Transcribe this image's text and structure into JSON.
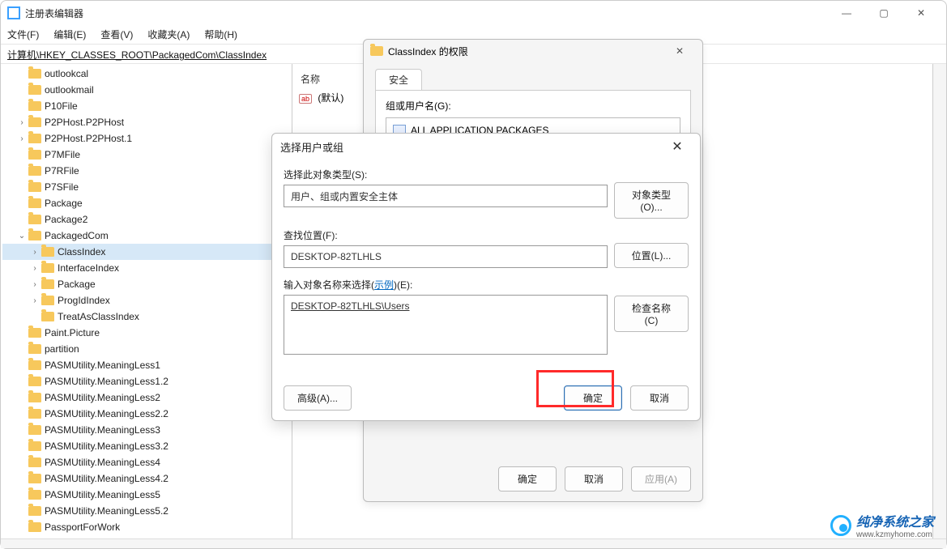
{
  "window": {
    "title": "注册表编辑器",
    "min_icon": "—",
    "max_icon": "▢",
    "close_icon": "✕"
  },
  "menubar": {
    "file": "文件(F)",
    "edit": "编辑(E)",
    "view": "查看(V)",
    "fav": "收藏夹(A)",
    "help": "帮助(H)"
  },
  "address": "计算机\\HKEY_CLASSES_ROOT\\PackagedCom\\ClassIndex",
  "right": {
    "name_col": "名称",
    "default_label": "(默认)",
    "ab_icon": "ab"
  },
  "tree": [
    {
      "lbl": "outlookcal",
      "depth": 1,
      "tw": "none"
    },
    {
      "lbl": "outlookmail",
      "depth": 1,
      "tw": "none"
    },
    {
      "lbl": "P10File",
      "depth": 1,
      "tw": "none"
    },
    {
      "lbl": "P2PHost.P2PHost",
      "depth": 1,
      "tw": "closed"
    },
    {
      "lbl": "P2PHost.P2PHost.1",
      "depth": 1,
      "tw": "closed"
    },
    {
      "lbl": "P7MFile",
      "depth": 1,
      "tw": "none"
    },
    {
      "lbl": "P7RFile",
      "depth": 1,
      "tw": "none"
    },
    {
      "lbl": "P7SFile",
      "depth": 1,
      "tw": "none"
    },
    {
      "lbl": "Package",
      "depth": 1,
      "tw": "none"
    },
    {
      "lbl": "Package2",
      "depth": 1,
      "tw": "none"
    },
    {
      "lbl": "PackagedCom",
      "depth": 1,
      "tw": "open"
    },
    {
      "lbl": "ClassIndex",
      "depth": 2,
      "tw": "closed",
      "sel": true
    },
    {
      "lbl": "InterfaceIndex",
      "depth": 2,
      "tw": "closed"
    },
    {
      "lbl": "Package",
      "depth": 2,
      "tw": "closed"
    },
    {
      "lbl": "ProgIdIndex",
      "depth": 2,
      "tw": "closed"
    },
    {
      "lbl": "TreatAsClassIndex",
      "depth": 2,
      "tw": "none"
    },
    {
      "lbl": "Paint.Picture",
      "depth": 1,
      "tw": "none"
    },
    {
      "lbl": "partition",
      "depth": 1,
      "tw": "none"
    },
    {
      "lbl": "PASMUtility.MeaningLess1",
      "depth": 1,
      "tw": "none"
    },
    {
      "lbl": "PASMUtility.MeaningLess1.2",
      "depth": 1,
      "tw": "none"
    },
    {
      "lbl": "PASMUtility.MeaningLess2",
      "depth": 1,
      "tw": "none"
    },
    {
      "lbl": "PASMUtility.MeaningLess2.2",
      "depth": 1,
      "tw": "none"
    },
    {
      "lbl": "PASMUtility.MeaningLess3",
      "depth": 1,
      "tw": "none"
    },
    {
      "lbl": "PASMUtility.MeaningLess3.2",
      "depth": 1,
      "tw": "none"
    },
    {
      "lbl": "PASMUtility.MeaningLess4",
      "depth": 1,
      "tw": "none"
    },
    {
      "lbl": "PASMUtility.MeaningLess4.2",
      "depth": 1,
      "tw": "none"
    },
    {
      "lbl": "PASMUtility.MeaningLess5",
      "depth": 1,
      "tw": "none"
    },
    {
      "lbl": "PASMUtility.MeaningLess5.2",
      "depth": 1,
      "tw": "none"
    },
    {
      "lbl": "PassportForWork",
      "depth": 1,
      "tw": "none"
    }
  ],
  "perm_dialog": {
    "title": "ClassIndex 的权限",
    "tab_security": "安全",
    "group_label": "组或用户名(G):",
    "group_entry": "ALL APPLICATION PACKAGES",
    "ok": "确定",
    "cancel": "取消",
    "apply": "应用(A)"
  },
  "sel_dialog": {
    "title": "选择用户或组",
    "close_icon": "✕",
    "obj_type_label": "选择此对象类型(S):",
    "obj_type_value": "用户、组或内置安全主体",
    "obj_type_btn": "对象类型(O)...",
    "loc_label": "查找位置(F):",
    "loc_value": "DESKTOP-82TLHLS",
    "loc_btn": "位置(L)...",
    "names_label_pre": "输入对象名称来选择(",
    "names_label_link": "示例",
    "names_label_post": ")(E):",
    "names_value": "DESKTOP-82TLHLS\\Users",
    "checknames_btn": "检查名称(C)",
    "advanced_btn": "高级(A)...",
    "ok": "确定",
    "cancel": "取消"
  },
  "watermark": {
    "line1": "纯净系统之家",
    "line2": "www.kzmyhome.com"
  }
}
